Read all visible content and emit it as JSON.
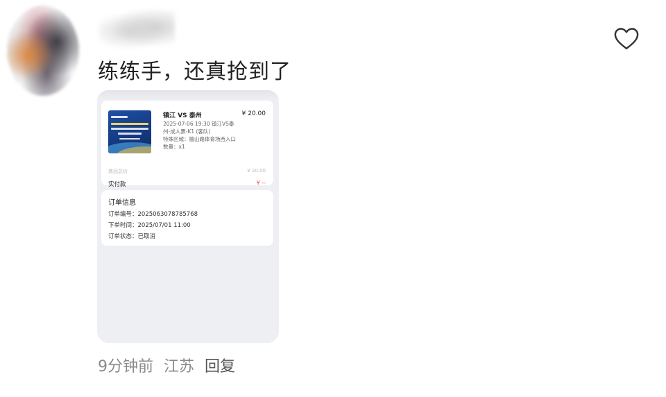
{
  "comment": {
    "text": "练练手，还真抢到了",
    "time": "9分钟前",
    "location": "江苏",
    "reply_label": "回复"
  },
  "icons": {
    "like": "heart-outline-icon"
  },
  "attachment": {
    "ticket": {
      "title": "镇江 VS 泰州",
      "price": "¥ 20.00",
      "line1": "2025-07-06 19:30 镇江VS泰",
      "line2": "州-成人票-K1 (客队)",
      "line3": "特殊区域：檀山路体育场西入口",
      "line4": "数量：x1",
      "subtotal_label": "商品总价",
      "subtotal_value": "¥ 20.00",
      "paid_label": "实付款",
      "paid_value": "¥ --"
    },
    "order": {
      "heading": "订单信息",
      "number": "订单编号：2025063078785768",
      "time": "下单时间：2025/07/01 11:00",
      "status": "订单状态：已取消"
    }
  },
  "colors": {
    "text_primary": "#222222",
    "text_meta": "#8a8a8a",
    "accent_red": "#e5484d",
    "screenshot_bg": "#edeff3"
  }
}
